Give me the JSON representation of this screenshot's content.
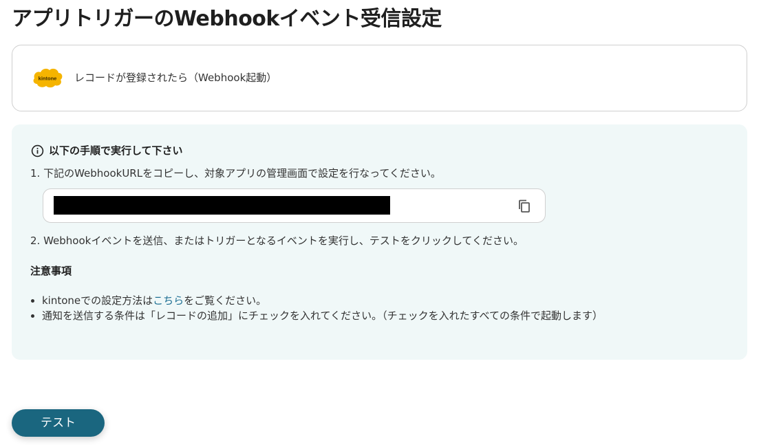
{
  "page": {
    "title": "アプリトリガーのWebhookイベント受信設定"
  },
  "trigger": {
    "app_icon": "kintone-logo",
    "app_logo_text": "kintone",
    "label": "レコードが登録されたら（Webhook起動）"
  },
  "instructions": {
    "icon": "info-icon",
    "title": "以下の手順で実行して下さい",
    "step1": "1. 下記のWebhookURLをコピーし、対象アプリの管理画面で設定を行なってください。",
    "webhook_url": "",
    "copy_icon": "copy-icon",
    "step2": "2. Webhookイベントを送信、またはトリガーとなるイベントを実行し、テストをクリックしてください。"
  },
  "notes": {
    "title": "注意事項",
    "item1_prefix": "kintoneでの設定方法は",
    "item1_link": "こちら",
    "item1_suffix": "をご覧ください。",
    "item2": "通知を送信する条件は「レコードの追加」にチェックを入れてください。（チェックを入れたすべての条件で起動します）"
  },
  "footer": {
    "test_button": "テスト"
  },
  "colors": {
    "accent": "#1a667f",
    "panel_bg": "#f0f8f8",
    "link": "#1e6f93",
    "kintone_yellow": "#f5b400"
  }
}
